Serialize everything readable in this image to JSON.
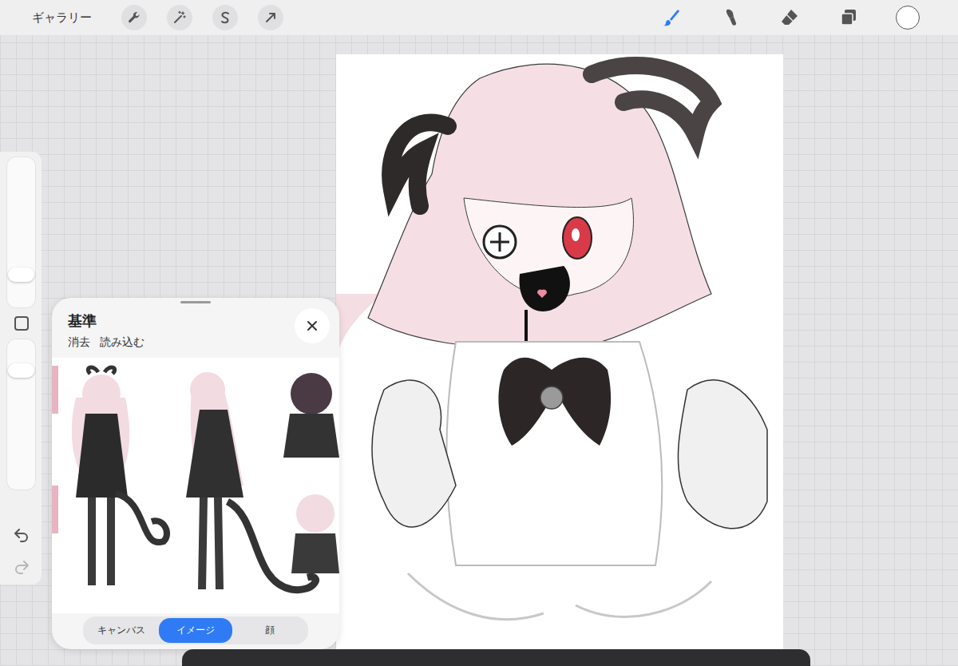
{
  "toolbar": {
    "gallery": "ギャラリー",
    "left_tools": [
      {
        "kind": "actions",
        "selected": false
      },
      {
        "kind": "adjust",
        "selected": false
      },
      {
        "kind": "select",
        "selected": false
      },
      {
        "kind": "transform",
        "selected": false
      }
    ],
    "right_tools": [
      {
        "kind": "brush",
        "selected": true
      },
      {
        "kind": "smudge",
        "selected": false
      },
      {
        "kind": "eraser",
        "selected": false
      },
      {
        "kind": "layers",
        "selected": false
      }
    ],
    "swatch": {
      "color": "#ffffff"
    }
  },
  "sidebar": {
    "sliders": [
      {
        "kind": "size",
        "level": 0.18
      },
      {
        "kind": "opacity",
        "level": 0.83
      }
    ],
    "undo": {
      "disabled": false
    },
    "redo": {
      "disabled": true
    }
  },
  "reference": {
    "title": "基準",
    "actions": [
      "消去",
      "読み込む"
    ],
    "close": {
      "disabled": false
    },
    "tabs": [
      {
        "label": "キャンバス",
        "selected": false
      },
      {
        "label": "イメージ",
        "selected": true
      },
      {
        "label": "顔",
        "selected": false
      }
    ]
  }
}
